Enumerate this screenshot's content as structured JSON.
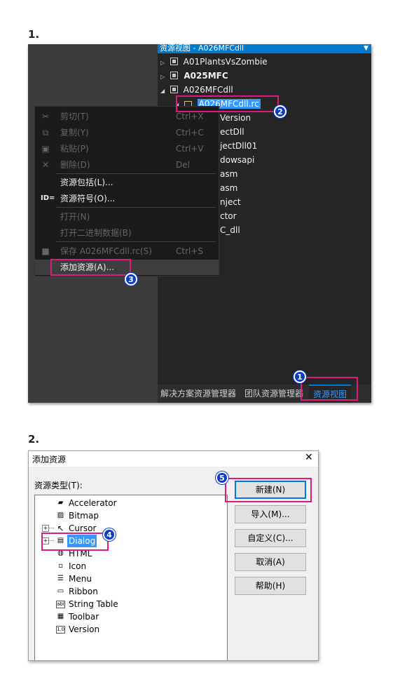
{
  "step1": {
    "label": "1."
  },
  "step2": {
    "label": "2."
  },
  "resource_view": {
    "header_title": "资源视图 - A026MFCdll",
    "dropdown_icon": "caret-down-icon",
    "tree": [
      {
        "text": "A01PlantsVsZombie",
        "bold": false
      },
      {
        "text": "A025MFC",
        "bold": true
      },
      {
        "text": "A026MFCdll",
        "bold": false
      },
      {
        "text": "A026MFCdll.rc",
        "selected": true
      }
    ],
    "partial_items": [
      "Version",
      "ectDll",
      "jectDll01",
      "dowsapi",
      "asm",
      "asm",
      "nject",
      "ctor",
      "C_dll"
    ]
  },
  "bottom_tabs": [
    "解决方案资源管理器",
    "团队资源管理器",
    "资源视图"
  ],
  "context_menu": {
    "items": [
      {
        "label": "剪切(T)",
        "shortcut": "Ctrl+X",
        "enabled": false,
        "icon": "scissors-icon"
      },
      {
        "label": "复制(Y)",
        "shortcut": "Ctrl+C",
        "enabled": false,
        "icon": "copy-icon"
      },
      {
        "label": "粘贴(P)",
        "shortcut": "Ctrl+V",
        "enabled": false,
        "icon": "paste-icon"
      },
      {
        "label": "删除(D)",
        "shortcut": "Del",
        "enabled": false,
        "icon": "delete-x-icon"
      },
      {
        "label": "资源包括(L)...",
        "shortcut": "",
        "enabled": true,
        "icon": ""
      },
      {
        "label": "资源符号(O)...",
        "shortcut": "",
        "enabled": true,
        "icon": "id-icon",
        "icon_text": "ID="
      },
      {
        "label": "打开(N)",
        "shortcut": "",
        "enabled": false,
        "icon": ""
      },
      {
        "label": "打开二进制数据(B)",
        "shortcut": "",
        "enabled": false,
        "icon": ""
      },
      {
        "label": "保存 A026MFCdll.rc(S)",
        "shortcut": "Ctrl+S",
        "enabled": false,
        "icon": "save-icon"
      },
      {
        "label": "添加资源(A)...",
        "shortcut": "",
        "enabled": true,
        "icon": "",
        "highlighted": true
      }
    ]
  },
  "dialog": {
    "title": "添加资源",
    "close_glyph": "✕",
    "resource_type_label": "资源类型(T):",
    "resource_types": [
      {
        "name": "Accelerator",
        "icon": "accelerator-icon",
        "expandable": false
      },
      {
        "name": "Bitmap",
        "icon": "bitmap-icon",
        "expandable": false
      },
      {
        "name": "Cursor",
        "icon": "cursor-icon",
        "expandable": true
      },
      {
        "name": "Dialog",
        "icon": "dialog-icon",
        "expandable": true,
        "selected": true
      },
      {
        "name": "HTML",
        "icon": "html-icon",
        "expandable": false
      },
      {
        "name": "Icon",
        "icon": "icon-resource-icon",
        "expandable": false
      },
      {
        "name": "Menu",
        "icon": "menu-icon",
        "expandable": false
      },
      {
        "name": "Ribbon",
        "icon": "ribbon-icon",
        "expandable": false
      },
      {
        "name": "String Table",
        "icon": "string-table-icon",
        "expandable": false,
        "icon_text": "abl"
      },
      {
        "name": "Toolbar",
        "icon": "toolbar-icon",
        "expandable": false
      },
      {
        "name": "Version",
        "icon": "version-icon",
        "expandable": false,
        "icon_text": "1.0"
      }
    ],
    "buttons": [
      "新建(N)",
      "导入(M)...",
      "自定义(C)...",
      "取消(A)",
      "帮助(H)"
    ]
  },
  "badges": [
    "1",
    "2",
    "3",
    "4",
    "5"
  ],
  "colors": {
    "highlight": "#e0197d",
    "badge": "#0a3cc8",
    "accent": "#007acc",
    "selection": "#3399ff"
  }
}
